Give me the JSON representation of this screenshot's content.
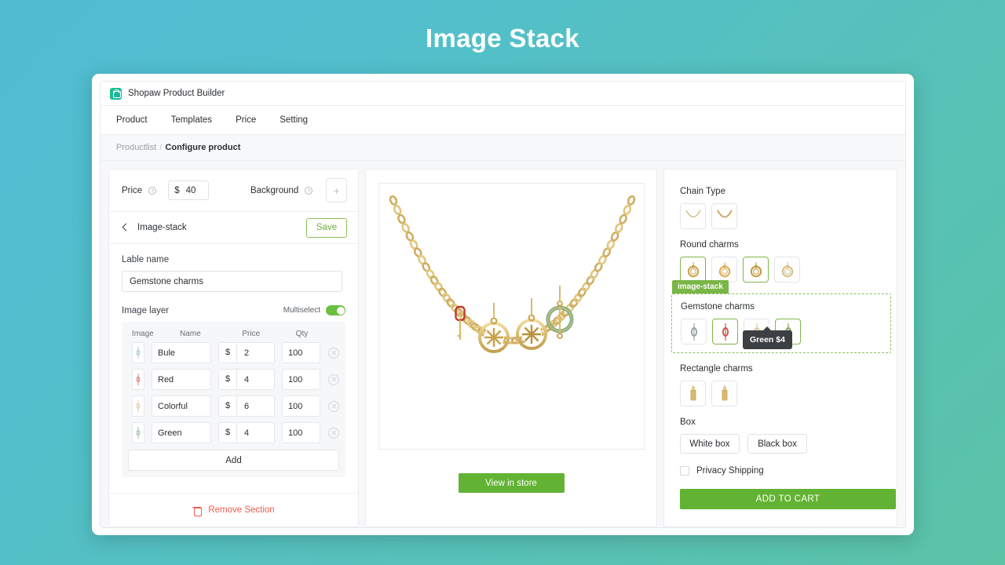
{
  "page": {
    "title": "Image Stack"
  },
  "app": {
    "title": "Shopaw Product Builder",
    "logo_icon": "shopping-bag-icon",
    "nav": [
      {
        "label": "Product"
      },
      {
        "label": "Templates"
      },
      {
        "label": "Price"
      },
      {
        "label": "Setting"
      }
    ],
    "breadcrumb": {
      "parent": "Productlist",
      "separator": "/",
      "current": "Configure product"
    }
  },
  "left_panel": {
    "price": {
      "label": "Price",
      "help_icon": "question-mark-icon",
      "currency": "$",
      "value": "40"
    },
    "background": {
      "label": "Background",
      "help_icon": "question-mark-icon",
      "add_icon": "plus-icon"
    },
    "section": {
      "back_icon": "chevron-left-icon",
      "title": "Image-stack",
      "save_label": "Save"
    },
    "label_name": {
      "field_label": "Lable name",
      "value": "Gemstone charms"
    },
    "image_layer": {
      "title": "Image layer",
      "multiselect_label": "Multiselect",
      "multiselect_on": true,
      "columns": [
        "Image",
        "Name",
        "Price",
        "Qty"
      ],
      "currency": "$",
      "rows": [
        {
          "thumb": "charm-thumb-blue",
          "name": "Bule",
          "price": "2",
          "qty": "100",
          "delete_icon": "close-circle-icon",
          "color": "#8fb8c9"
        },
        {
          "thumb": "charm-thumb-red",
          "name": "Red",
          "price": "4",
          "qty": "100",
          "delete_icon": "close-circle-icon",
          "color": "#d0584c"
        },
        {
          "thumb": "charm-thumb-colorful",
          "name": "Colorful",
          "price": "6",
          "qty": "100",
          "delete_icon": "close-circle-icon",
          "color": "#d8c08a"
        },
        {
          "thumb": "charm-thumb-green",
          "name": "Green",
          "price": "4",
          "qty": "100",
          "delete_icon": "close-circle-icon",
          "color": "#7bb38d"
        }
      ],
      "add_label": "Add"
    },
    "remove_section": {
      "icon": "trash-icon",
      "label": "Remove Section"
    }
  },
  "center_panel": {
    "preview_alt": "gold chain necklace with charms",
    "view_in_store_label": "View in store"
  },
  "right_panel": {
    "chain_type": {
      "title": "Chain Type",
      "options": [
        {
          "name": "chain-thin",
          "selected": false
        },
        {
          "name": "chain-thick",
          "selected": false
        }
      ]
    },
    "round_charms": {
      "title": "Round charms",
      "options": [
        {
          "name": "round-charm-1",
          "selected": true,
          "color": "#c9a24a"
        },
        {
          "name": "round-charm-2",
          "selected": false,
          "color": "#d9ab52"
        },
        {
          "name": "round-charm-3",
          "selected": true,
          "color": "#c39a43"
        },
        {
          "name": "round-charm-4",
          "selected": false,
          "color": "#d6bf86"
        }
      ]
    },
    "stack_tag": "image-stack",
    "gemstone_charms": {
      "title": "Gemstone charms",
      "options": [
        {
          "name": "gemstone-charm-blue",
          "selected": false,
          "color": "#9aa2a6"
        },
        {
          "name": "gemstone-charm-red",
          "selected": true,
          "color": "#c9584a"
        },
        {
          "name": "gemstone-charm-colorful",
          "selected": false,
          "color": "#d8c79a"
        },
        {
          "name": "gemstone-charm-green",
          "selected": true,
          "color": "#8aa860"
        }
      ]
    },
    "tooltip": {
      "text": "Green $4"
    },
    "rectangle_charms": {
      "title": "Rectangle charms",
      "options": [
        {
          "name": "rect-charm-1",
          "selected": false,
          "color": "#d8bb72"
        },
        {
          "name": "rect-charm-2",
          "selected": false,
          "color": "#d8bb72"
        }
      ]
    },
    "box": {
      "title": "Box",
      "options": [
        {
          "label": "White box"
        },
        {
          "label": "Black box"
        }
      ]
    },
    "privacy_shipping": {
      "label": "Privacy Shipping",
      "checked": false
    },
    "add_to_cart_label": "ADD TO CART"
  },
  "colors": {
    "brand_green": "#62b333",
    "accent_green": "#7ab547",
    "danger_red": "#ef5b4c",
    "bg_gradient_start": "#4fbcd2",
    "bg_gradient_end": "#5bc3a6"
  }
}
